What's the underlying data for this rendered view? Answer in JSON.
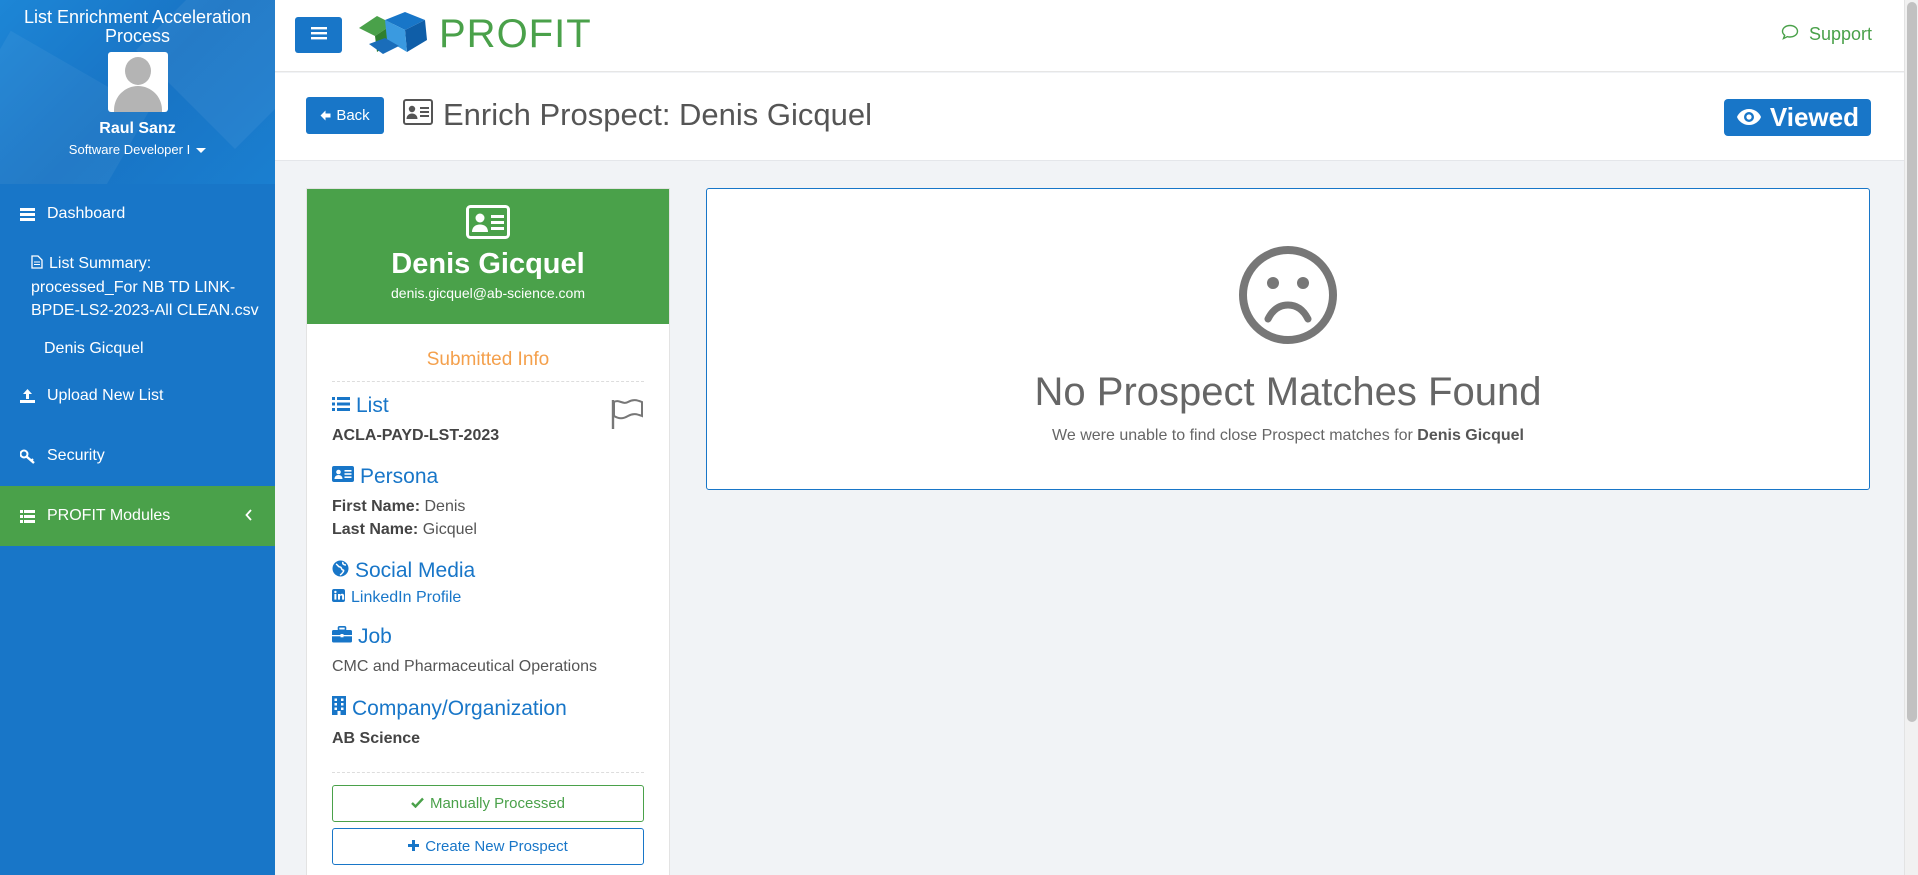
{
  "app": {
    "title": "List Enrichment Acceleration Process",
    "logo_text": "PROFIT",
    "support_label": "Support"
  },
  "user": {
    "name": "Raul Sanz",
    "role": "Software Developer I"
  },
  "sidebar": {
    "items": [
      {
        "label": "Dashboard",
        "icon": "dashboard-icon"
      },
      {
        "label": "List Summary: processed_For NB TD LINK-BPDE-LS2-2023-All CLEAN.csv",
        "icon": "file-icon"
      },
      {
        "label": "Denis Gicquel"
      },
      {
        "label": "Upload New List",
        "icon": "upload-icon"
      },
      {
        "label": "Security",
        "icon": "key-icon"
      },
      {
        "label": "PROFIT Modules",
        "icon": "list-icon",
        "active": true
      }
    ]
  },
  "header": {
    "back_label": "Back",
    "title": "Enrich Prospect: Denis Gicquel",
    "status_badge": "Viewed"
  },
  "prospect": {
    "name": "Denis Gicquel",
    "email": "denis.gicquel@ab-science.com",
    "submitted_info_label": "Submitted Info",
    "list": {
      "title": "List",
      "value": "ACLA-PAYD-LST-2023"
    },
    "persona": {
      "title": "Persona",
      "first_name_label": "First Name:",
      "first_name": "Denis",
      "last_name_label": "Last Name:",
      "last_name": "Gicquel"
    },
    "social": {
      "title": "Social Media",
      "linkedin_label": "LinkedIn Profile"
    },
    "job": {
      "title": "Job",
      "value": "CMC and Pharmaceutical Operations"
    },
    "company": {
      "title": "Company/Organization",
      "value": "AB Science"
    },
    "buttons": {
      "manually_processed": "Manually Processed",
      "create_new": "Create New Prospect"
    }
  },
  "no_match": {
    "title": "No Prospect Matches Found",
    "message_prefix": "We were unable to find close Prospect matches for",
    "message_name": "Denis Gicquel"
  },
  "colors": {
    "primary_blue": "#1876c8",
    "green": "#4aa14a",
    "orange": "#f4a04c"
  }
}
